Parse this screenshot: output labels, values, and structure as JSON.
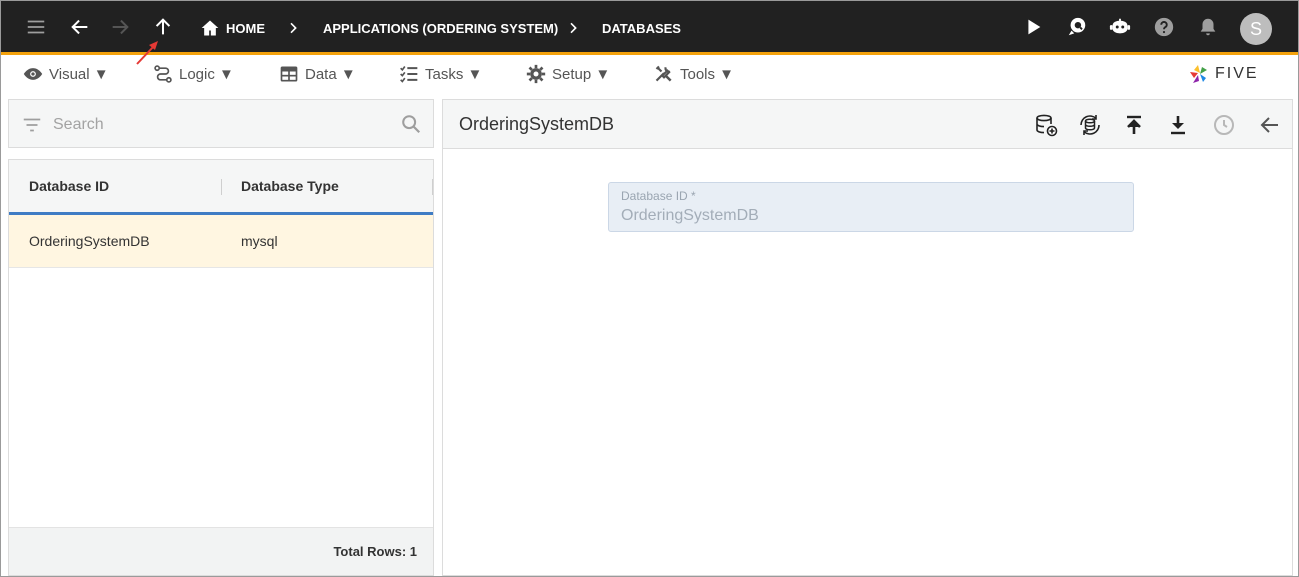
{
  "topbar": {
    "breadcrumbs": [
      "HOME",
      "APPLICATIONS (ORDERING SYSTEM)",
      "DATABASES"
    ],
    "avatar_initial": "S",
    "accent_color": "#f4a20c"
  },
  "menus": [
    {
      "label": "Visual ▼",
      "icon": "eye-icon"
    },
    {
      "label": "Logic ▼",
      "icon": "flow-icon"
    },
    {
      "label": "Data ▼",
      "icon": "table-icon"
    },
    {
      "label": "Tasks ▼",
      "icon": "checklist-icon"
    },
    {
      "label": "Setup ▼",
      "icon": "gear-icon"
    },
    {
      "label": "Tools ▼",
      "icon": "tools-icon"
    }
  ],
  "logo": {
    "text": "FIVE"
  },
  "search": {
    "placeholder": "Search"
  },
  "grid": {
    "columns": [
      "Database ID",
      "Database Type"
    ],
    "rows": [
      {
        "id": "OrderingSystemDB",
        "type": "mysql"
      }
    ],
    "footer": "Total Rows: 1",
    "selected_color": "#fff6e1",
    "header_accent": "#3f7cc4"
  },
  "detail": {
    "title": "OrderingSystemDB",
    "field": {
      "label": "Database ID *",
      "value": "OrderingSystemDB"
    }
  }
}
